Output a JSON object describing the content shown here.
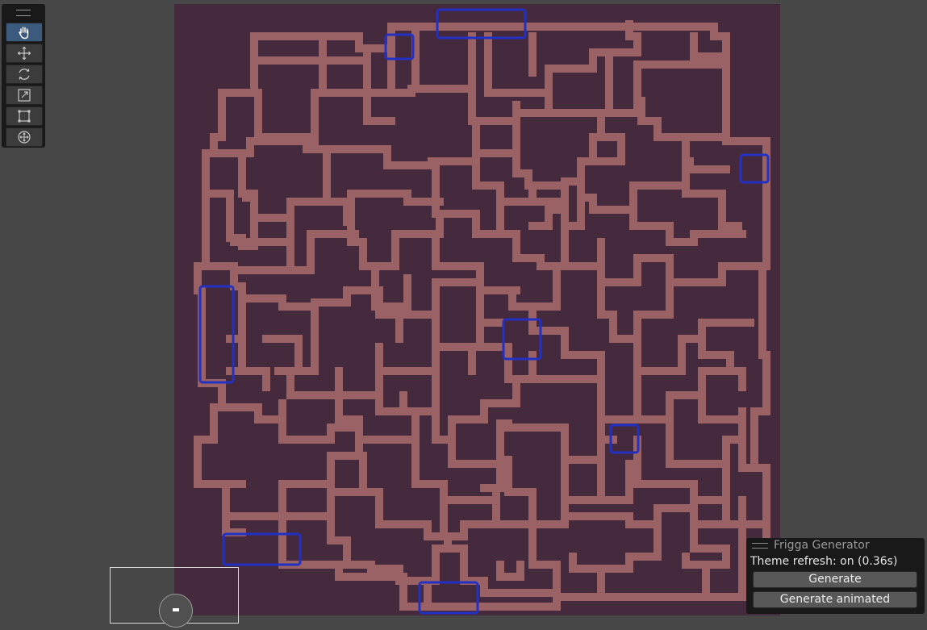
{
  "toolbar": {
    "tools": [
      {
        "name": "hand-tool",
        "icon": "hand-icon",
        "active": true
      },
      {
        "name": "move-tool",
        "icon": "move-arrows-icon",
        "active": false
      },
      {
        "name": "rotate-tool",
        "icon": "rotate-icon",
        "active": false
      },
      {
        "name": "scale-tool",
        "icon": "scale-icon",
        "active": false
      },
      {
        "name": "rect-tool",
        "icon": "rect-transform-icon",
        "active": false
      },
      {
        "name": "transform-tool",
        "icon": "transform-gizmo-icon",
        "active": false
      }
    ]
  },
  "map": {
    "background_color": "#452a3d",
    "wall_color": "#9a6264",
    "highlight_color": "#2230c4"
  },
  "generator": {
    "title": "Frigga Generator",
    "status": "Theme refresh: on (0.36s)",
    "generate_label": "Generate",
    "generate_animated_label": "Generate animated"
  }
}
